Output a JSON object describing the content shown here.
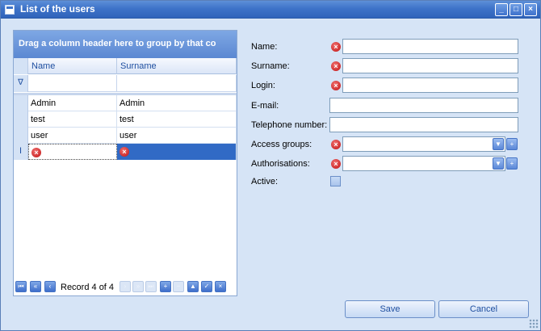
{
  "window": {
    "title": "List of the users"
  },
  "grid": {
    "group_panel_text": "Drag a column header here to group by that co",
    "columns": [
      "Name",
      "Surname"
    ],
    "filter_icon": "funnel-icon",
    "rows": [
      {
        "name": "Admin",
        "surname": "Admin"
      },
      {
        "name": "test",
        "surname": "test"
      },
      {
        "name": "user",
        "surname": "user"
      }
    ],
    "new_row_indicator": "I",
    "navigator": {
      "record_text": "Record 4 of 4"
    }
  },
  "form": {
    "name_label": "Name:",
    "surname_label": "Surname:",
    "login_label": "Login:",
    "email_label": "E-mail:",
    "phone_label": "Telephone number:",
    "access_groups_label": "Access groups:",
    "authorisations_label": "Authorisations:",
    "active_label": "Active:",
    "name_value": "",
    "surname_value": "",
    "login_value": "",
    "email_value": "",
    "phone_value": ""
  },
  "buttons": {
    "save": "Save",
    "cancel": "Cancel"
  },
  "colors": {
    "accent": "#316ac5",
    "error": "#c11010",
    "window_bg": "#d6e4f6"
  }
}
